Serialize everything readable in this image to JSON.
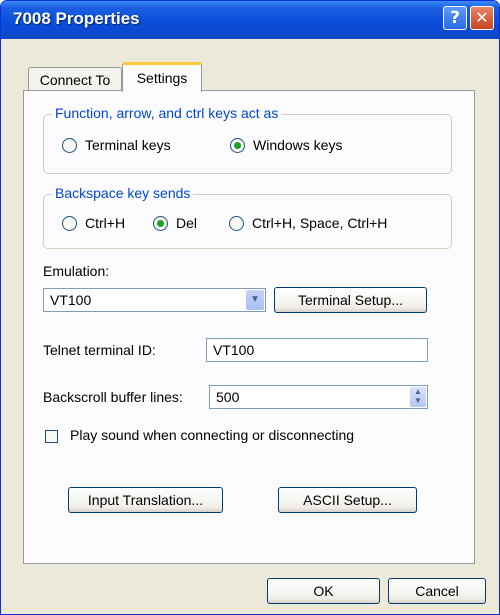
{
  "window": {
    "title": "7008 Properties",
    "help_glyph": "?",
    "close_glyph": "✕"
  },
  "tabs": [
    {
      "label": "Connect To",
      "active": false
    },
    {
      "label": "Settings",
      "active": true
    }
  ],
  "function_keys": {
    "legend": "Function, arrow, and ctrl keys act as",
    "options": [
      {
        "label": "Terminal keys",
        "selected": false
      },
      {
        "label": "Windows keys",
        "selected": true
      }
    ]
  },
  "backspace": {
    "legend": "Backspace key sends",
    "options": [
      {
        "label": "Ctrl+H",
        "selected": false
      },
      {
        "label": "Del",
        "selected": true
      },
      {
        "label": "Ctrl+H, Space, Ctrl+H",
        "selected": false
      }
    ]
  },
  "emulation": {
    "label": "Emulation:",
    "value": "VT100",
    "terminal_setup_label": "Terminal Setup..."
  },
  "telnet": {
    "label": "Telnet terminal ID:",
    "value": "VT100"
  },
  "backscroll": {
    "label": "Backscroll buffer lines:",
    "value": "500"
  },
  "play_sound": {
    "label": "Play sound when connecting or disconnecting",
    "checked": false
  },
  "buttons": {
    "input_translation": "Input Translation...",
    "ascii_setup": "ASCII Setup...",
    "ok": "OK",
    "cancel": "Cancel"
  },
  "colors": {
    "title_bar": "#0A4EDB",
    "legend_text": "#0046D5",
    "dialog_bg": "#ECE9D8"
  }
}
